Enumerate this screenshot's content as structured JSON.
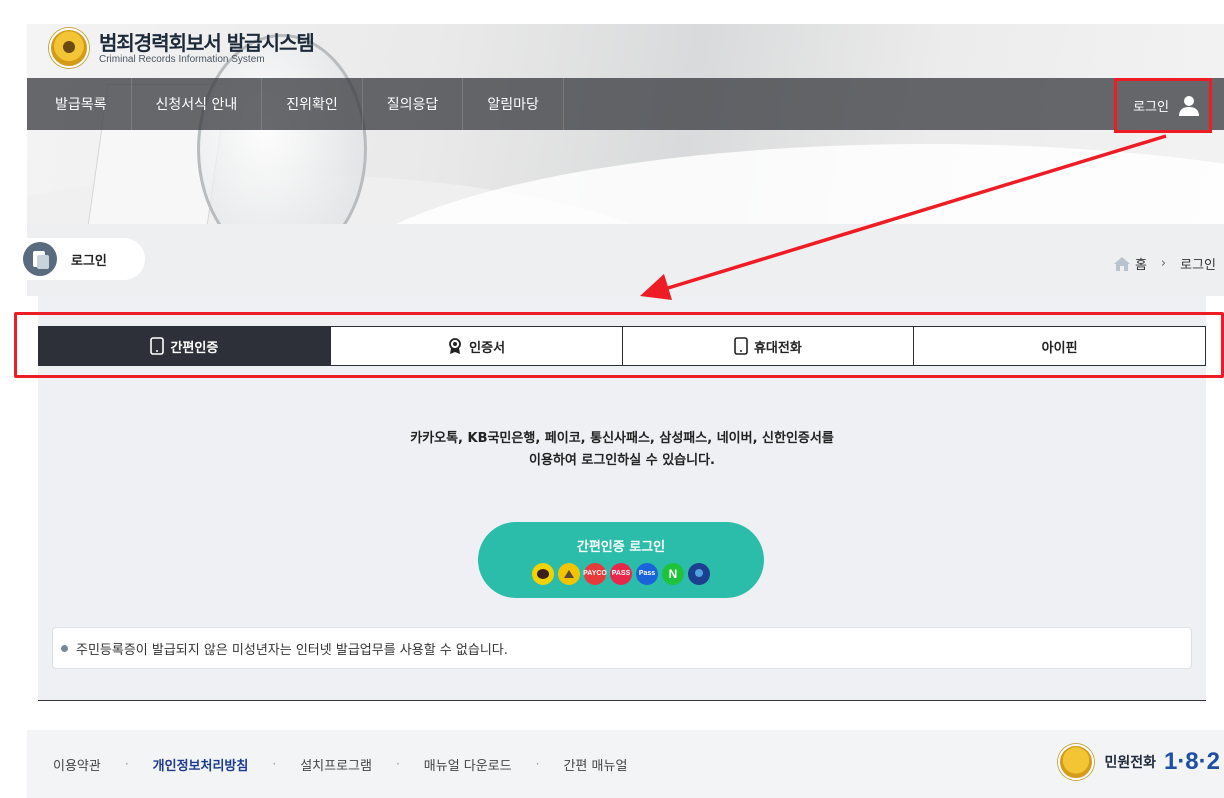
{
  "header": {
    "title": "범죄경력회보서 발급시스템",
    "subtitle": "Criminal Records Information System",
    "login_label": "로그인"
  },
  "nav": {
    "items": [
      {
        "label": "발급목록"
      },
      {
        "label": "신청서식 안내"
      },
      {
        "label": "진위확인"
      },
      {
        "label": "질의응답"
      },
      {
        "label": "알림마당"
      }
    ]
  },
  "page": {
    "title": "로그인",
    "breadcrumb": {
      "home": "홈",
      "current": "로그인"
    }
  },
  "tabs": [
    {
      "label": "간편인증",
      "icon": "phone-icon",
      "active": true
    },
    {
      "label": "인증서",
      "icon": "certificate-icon",
      "active": false
    },
    {
      "label": "휴대전화",
      "icon": "phone-icon",
      "active": false
    },
    {
      "label": "아이핀",
      "icon": "",
      "active": false
    }
  ],
  "simple_auth": {
    "description_line1": "카카오톡, KB국민은행, 페이코, 통신사패스, 삼성패스, 네이버, 신한인증서를",
    "description_line2": "이용하여 로그인하실 수 있습니다.",
    "button_label": "간편인증 로그인",
    "providers": [
      {
        "name": "kakao-icon",
        "color": "#f2d300",
        "text": ""
      },
      {
        "name": "kb-icon",
        "color": "#f5c400",
        "text": ""
      },
      {
        "name": "payco-icon",
        "color": "#e83a3a",
        "text": "PAYCO"
      },
      {
        "name": "pass-icon",
        "color": "#e8284a",
        "text": "PASS"
      },
      {
        "name": "samsung-pass-icon",
        "color": "#1b63d8",
        "text": "Pass"
      },
      {
        "name": "naver-icon",
        "color": "#1fc33b",
        "text": "N"
      },
      {
        "name": "shinhan-icon",
        "color": "#1c3f8f",
        "text": ""
      }
    ]
  },
  "notice": "주민등록증이 발급되지 않은 미성년자는 인터넷 발급업무를 사용할 수 없습니다.",
  "footer": {
    "links": [
      {
        "label": "이용약관",
        "bold": false
      },
      {
        "label": "개인정보처리방침",
        "bold": true
      },
      {
        "label": "설치프로그램",
        "bold": false
      },
      {
        "label": "매뉴얼 다운로드",
        "bold": false
      },
      {
        "label": "간편 매뉴얼",
        "bold": false
      }
    ],
    "call_label": "민원전화",
    "call_number": "1·8·2"
  },
  "colors": {
    "accent_teal": "#2bbdaa",
    "active_tab": "#2d3039",
    "highlight_red": "#ee1c25",
    "footer_bold_link": "#1d3b8c"
  }
}
